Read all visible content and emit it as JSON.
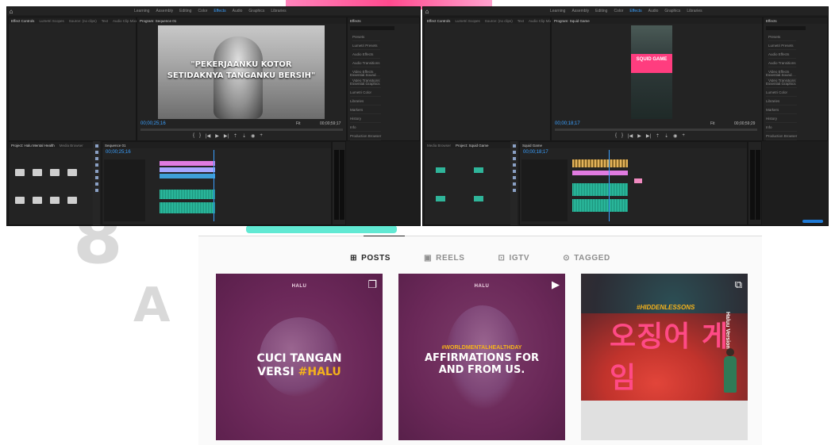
{
  "premiere_left": {
    "workspaces": [
      "Learning",
      "Assembly",
      "Editing",
      "Color",
      "Effects",
      "Audio",
      "Graphics",
      "Libraries"
    ],
    "active_workspace": "Effects",
    "source_tabs": [
      "Effect Controls",
      "Lumetri Scopes",
      "Source: (no clips)",
      "Text",
      "Audio Clip Mixer: Sequence 01"
    ],
    "program_label": "Program: Sequence 01",
    "caption_line1": "\"PEKERJAANKU KOTOR",
    "caption_line2": "SETIDAKNYA TANGANKU BERSIH\"",
    "timecode": "00;00;25;16",
    "duration": "00;00;59;17",
    "fit": "Fit",
    "project_tabs": [
      "Project: Halu Mental Health",
      "Media Browser"
    ],
    "timeline_tab": "Sequence 01",
    "timeline_timecode": "00;00;25;16",
    "effects_title": "Effects",
    "effects_items": [
      "Presets",
      "Lumetri Presets",
      "Audio Effects",
      "Audio Transitions",
      "Video Effects",
      "Video Transitions"
    ],
    "effects_sections": [
      "Essential Sound",
      "Essential Graphics",
      "Lumetri Color",
      "Libraries",
      "Markers",
      "History",
      "Info",
      "Production Browser"
    ]
  },
  "premiere_right": {
    "workspaces": [
      "Learning",
      "Assembly",
      "Editing",
      "Color",
      "Effects",
      "Audio",
      "Graphics",
      "Libraries"
    ],
    "active_workspace": "Effects",
    "source_tabs": [
      "Effect Controls",
      "Lumetri Scopes",
      "Source: (no clips)",
      "Text",
      "Audio Clip Mixer: Squid Game"
    ],
    "program_label": "Program: Squid Game",
    "title_text": "SQUID GAME",
    "timecode": "00;00;18;17",
    "duration": "00;00;59;29",
    "fit": "Fit",
    "project_tabs": [
      "Media Browser",
      "Project: Squid Game"
    ],
    "timeline_tab": "Squid Game",
    "timeline_timecode": "00;00;18;17",
    "effects_title": "Effects",
    "effects_items": [
      "Presets",
      "Lumetri Presets",
      "Audio Effects",
      "Audio Transitions",
      "Video Effects",
      "Video Transitions"
    ],
    "effects_sections": [
      "Essential Sound",
      "Essential Graphics",
      "Lumetri Color",
      "Libraries",
      "Markers",
      "History",
      "Info",
      "Production Browser"
    ]
  },
  "instagram": {
    "tabs": [
      {
        "label": "POSTS",
        "icon": "grid-icon",
        "active": true
      },
      {
        "label": "REELS",
        "icon": "reels-icon",
        "active": false
      },
      {
        "label": "IGTV",
        "icon": "igtv-icon",
        "active": false
      },
      {
        "label": "TAGGED",
        "icon": "tagged-icon",
        "active": false
      }
    ],
    "posts": [
      {
        "brand": "HALU",
        "title_line1": "CUCI TANGAN",
        "title_line2a": "VERSI ",
        "title_line2b": "#HALU",
        "type_icon": "carousel-icon"
      },
      {
        "brand": "HALU",
        "hashtag": "#WORLDMENTALHEALTHDAY",
        "title_line1": "AFFIRMATIONS FOR",
        "title_line2": "AND FROM US.",
        "type_icon": "video-icon"
      },
      {
        "hashtag": "#HIDDENLESSONS",
        "title": "오징어 게임",
        "side_text": "Haluu Version",
        "type_icon": "reels-icon"
      }
    ],
    "colors": {
      "post_bg": "#6b2859",
      "accent": "#f5b21b",
      "squid_pink": "#ff4a86"
    }
  }
}
